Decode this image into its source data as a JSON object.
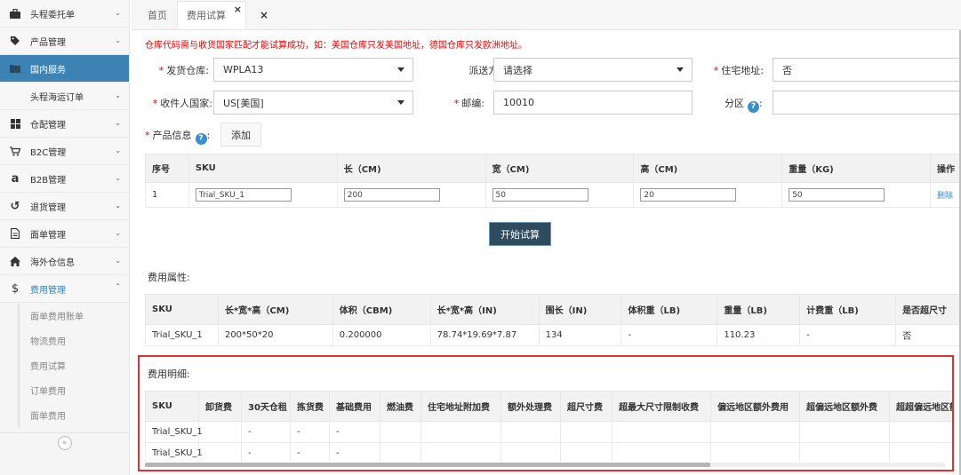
{
  "sidebar": {
    "items": [
      {
        "label": "头程委托单",
        "icon": "briefcase-icon",
        "glyph": "💼"
      },
      {
        "label": "产品管理",
        "icon": "tag-icon",
        "glyph": "🏷"
      },
      {
        "label": "国内服务",
        "icon": "folder-icon",
        "glyph": "▬"
      },
      {
        "label": "头程海运订单",
        "icon": "",
        "glyph": ""
      },
      {
        "label": "仓配管理",
        "icon": "grid-icon",
        "glyph": "▦"
      },
      {
        "label": "B2C管理",
        "icon": "cart-icon",
        "glyph": "🛒"
      },
      {
        "label": "B2B管理",
        "icon": "amazon-icon",
        "glyph": "a"
      },
      {
        "label": "退货管理",
        "icon": "undo-icon",
        "glyph": "↺"
      },
      {
        "label": "面单管理",
        "icon": "file-icon",
        "glyph": "🗎"
      },
      {
        "label": "海外仓信息",
        "icon": "home-icon",
        "glyph": "⌂"
      },
      {
        "label": "费用管理",
        "icon": "dollar-icon",
        "glyph": "$"
      }
    ],
    "sub_items": [
      "面单费用账单",
      "物流费用",
      "费用试算",
      "订单费用",
      "面单费用"
    ],
    "collapse_glyph": "«"
  },
  "tabs": {
    "home": "首页",
    "active": "费用试算",
    "close_glyph": "×"
  },
  "notice": "仓库代码需与收货国家匹配才能试算成功，如：美国仓库只发美国地址，德国仓库只发欧洲地址。",
  "form": {
    "required_mark": "*",
    "warehouse_label": "发货仓库:",
    "warehouse_value": "WPLA13",
    "delivery_label": "派送方式:",
    "delivery_value": "请选择",
    "residential_label": "住宅地址:",
    "residential_value": "否",
    "country_label": "收件人国家:",
    "country_value": "US[美国]",
    "zipcode_label": "邮编:",
    "zipcode_value": "10010",
    "zone_label": "分区",
    "zone_colon": ":",
    "product_label": "产品信息",
    "product_colon": ":",
    "help_glyph": "?",
    "add_button": "添加"
  },
  "product_table": {
    "headers": [
      "序号",
      "SKU",
      "长（CM)",
      "宽（CM)",
      "高（CM)",
      "重量（KG)",
      "操作"
    ],
    "row": {
      "index": "1",
      "sku": "Trial_SKU_1",
      "length": "200",
      "width": "50",
      "height": "20",
      "weight": "50",
      "action": "删除"
    }
  },
  "calc_button": "开始试算",
  "attr_section": {
    "title": "费用属性:",
    "headers": [
      "SKU",
      "长*宽*高（CM)",
      "体积（CBM)",
      "长*宽*高（IN)",
      "围长（IN)",
      "体积重（LB)",
      "重量（LB)",
      "计费重（LB)",
      "是否超尺寸"
    ],
    "row": [
      "Trial_SKU_1",
      "200*50*20",
      "0.200000",
      "78.74*19.69*7.87",
      "134",
      "-",
      "110.23",
      "-",
      "否"
    ]
  },
  "detail_section": {
    "title": "费用明细:",
    "headers": [
      "SKU",
      "卸货费",
      "30天仓租",
      "拣货费",
      "基础费用",
      "燃油费",
      "住宅地址附加费",
      "额外处理费",
      "超尺寸费",
      "超最大尺寸限制收费",
      "偏远地区额外费用",
      "超偏远地区额外费",
      "超超偏远地区额"
    ],
    "rows": [
      [
        "Trial_SKU_1",
        "",
        "-",
        "-",
        "-",
        "",
        "",
        "",
        "",
        "",
        "",
        "",
        ""
      ],
      [
        "Trial_SKU_1",
        "",
        "-",
        "-",
        "-",
        "",
        "",
        "",
        "",
        "",
        "",
        "",
        ""
      ]
    ]
  }
}
